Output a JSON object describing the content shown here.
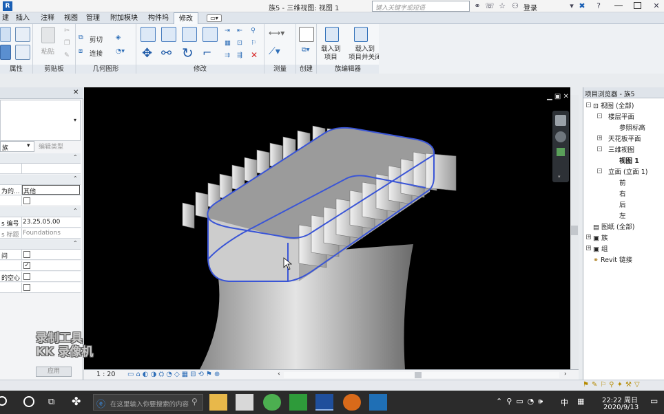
{
  "title_bar": {
    "title": "族5 - 三维视图: 视图 1",
    "search_placeholder": "键入关键字或短语",
    "login_label": "登录"
  },
  "tabs": [
    "建",
    "插入",
    "注释",
    "视图",
    "管理",
    "附加模块",
    "构件坞",
    "修改"
  ],
  "active_tab": "修改",
  "ribbon": {
    "panels": {
      "properties": "属性",
      "clipboard": "剪贴板",
      "geometry": "几何图形",
      "modify": "修改",
      "measure": "测量",
      "create": "创建",
      "family_editor": "族编辑器"
    },
    "clipboard_paste": "粘贴",
    "geometry_cut": "剪切",
    "geometry_join": "连接",
    "load_into_project": "载入到\n项目",
    "load_into_project_close": "载入到\n项目并关闭"
  },
  "properties_panel": {
    "type_selector_label": "族",
    "edit_type_button": "编辑类型",
    "rows": [
      {
        "label": "为的...",
        "value": "其他"
      },
      {
        "label": "",
        "checkbox": false
      },
      {
        "label": "s 编号",
        "value": "23.25.05.00"
      },
      {
        "label": "s 标题",
        "value": "Foundations"
      },
      {
        "label": "间",
        "checkbox": false
      },
      {
        "label": "",
        "checkbox": true
      },
      {
        "label": "的空心",
        "checkbox": false
      },
      {
        "label": "",
        "checkbox": false
      }
    ],
    "apply_button": "应用"
  },
  "view_bar": {
    "scale": "1 : 20"
  },
  "project_browser": {
    "title": "项目浏览器 - 族5",
    "tree": [
      {
        "label": "视图 (全部)",
        "level": 0,
        "expander": "-"
      },
      {
        "label": "楼层平面",
        "level": 1,
        "expander": "-"
      },
      {
        "label": "参照标高",
        "level": 2
      },
      {
        "label": "天花板平面",
        "level": 1,
        "expander": "+"
      },
      {
        "label": "三维视图",
        "level": 1,
        "expander": "-"
      },
      {
        "label": "视图 1",
        "level": 2,
        "bold": true
      },
      {
        "label": "立面 (立面 1)",
        "level": 1,
        "expander": "-"
      },
      {
        "label": "前",
        "level": 2
      },
      {
        "label": "右",
        "level": 2
      },
      {
        "label": "后",
        "level": 2
      },
      {
        "label": "左",
        "level": 2
      },
      {
        "label": "图纸 (全部)",
        "level": 0
      },
      {
        "label": "族",
        "level": 0,
        "expander": "+"
      },
      {
        "label": "组",
        "level": 0,
        "expander": "+"
      },
      {
        "label": "Revit 链接",
        "level": 0
      }
    ]
  },
  "watermark": {
    "line1": "录制工具",
    "line2": "KK 录像机"
  },
  "taskbar": {
    "search_placeholder": "在这里输入你要搜索的内容",
    "ime_label": "中",
    "time": "22:22 周日",
    "date": "2020/9/13"
  },
  "colors": {
    "selection_edge": "#3a55d6",
    "viewport_bg": "#000000",
    "taskbar_bg": "#2b2b2b"
  }
}
